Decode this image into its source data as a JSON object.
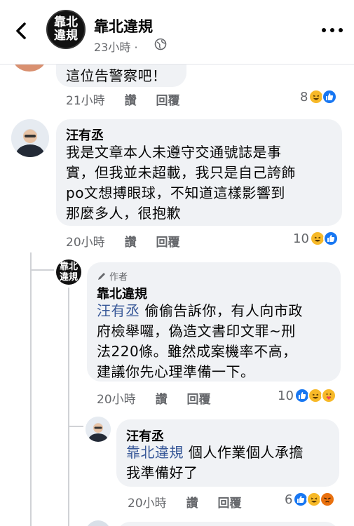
{
  "header": {
    "page_name": "靠北違規",
    "time": "23小時",
    "avatar_line1": "靠北",
    "avatar_line2": "違規"
  },
  "comment0": {
    "partial_text": "這位告警察吧！",
    "time": "21小時",
    "like": "讚",
    "reply": "回覆",
    "reaction_count": "8"
  },
  "comment1": {
    "name": "汪有丞",
    "lines": [
      "我是文章本人未遵守交通號誌是事",
      "實，但我並未超載，我只是自己誇飾",
      "po文想搏眼球，不知道這樣影響到",
      "那麼多人，很抱歉"
    ],
    "time": "20小時",
    "like": "讚",
    "reply": "回覆",
    "reaction_count": "10"
  },
  "reply1": {
    "author_badge": "作者",
    "name": "靠北違規",
    "mention": "汪有丞",
    "line1_rest": " 偷偷告訴你，有人向市政",
    "lines": [
      "府檢舉囉，偽造文書印文罪~刑",
      "法220條。雖然成案機率不高，",
      "建議你先心理準備一下。"
    ],
    "time": "20小時",
    "like": "讚",
    "reply": "回覆",
    "reaction_count": "10",
    "avatar_line1": "靠北",
    "avatar_line2": "違規"
  },
  "reply2": {
    "name": "汪有丞",
    "mention": "靠北違規",
    "line1_rest": " 個人作業個人承擔",
    "line2": "我準備好了",
    "time": "20小時",
    "like": "讚",
    "reply": "回覆",
    "reaction_count": "6"
  },
  "icons": {
    "back": "back-arrow-icon",
    "globe": "globe-icon",
    "more": "more-options-icon",
    "pencil": "pencil-icon"
  },
  "colors": {
    "mention": "#385898",
    "like_blue": "#1877f2",
    "haha_yellow": "#f7b928",
    "bubble": "#f0f2f5",
    "secondary_text": "#65676b"
  }
}
